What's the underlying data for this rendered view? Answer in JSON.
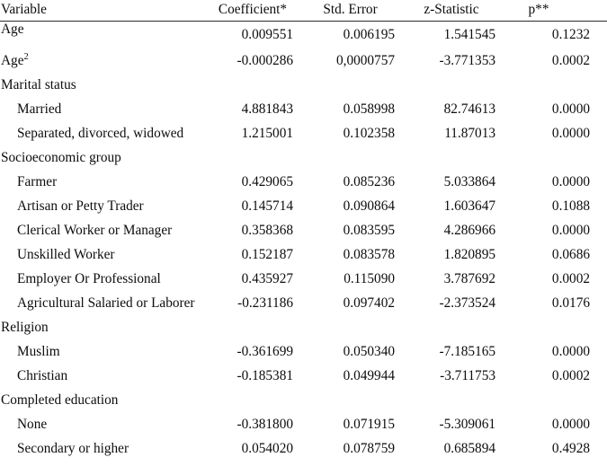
{
  "table": {
    "columns": [
      {
        "key": "variable",
        "label": "Variable",
        "align": "left"
      },
      {
        "key": "coefficient",
        "label": "Coefficient*",
        "align": "right"
      },
      {
        "key": "std_error",
        "label": "Std. Error",
        "align": "right"
      },
      {
        "key": "z_statistic",
        "label": "z-Statistic",
        "align": "right"
      },
      {
        "key": "p_value",
        "label": "p**",
        "align": "right"
      }
    ],
    "rows": [
      {
        "type": "data",
        "label": "Age",
        "label_sup": "",
        "indent": false,
        "coefficient": "0.009551",
        "std_error": "0.006195",
        "z_statistic": "1.541545",
        "p_value": "0.1232"
      },
      {
        "type": "data",
        "label": "Age",
        "label_sup": "2",
        "indent": false,
        "coefficient": "-0.000286",
        "std_error": "0,0000757",
        "z_statistic": "-3.771353",
        "p_value": "0.0002"
      },
      {
        "type": "section",
        "label": "Marital status",
        "label_sup": "",
        "indent": false,
        "coefficient": "",
        "std_error": "",
        "z_statistic": "",
        "p_value": ""
      },
      {
        "type": "data",
        "label": "Married",
        "label_sup": "",
        "indent": true,
        "coefficient": "4.881843",
        "std_error": "0.058998",
        "z_statistic": "82.74613",
        "p_value": "0.0000"
      },
      {
        "type": "data",
        "label": "Separated, divorced, widowed",
        "label_sup": "",
        "indent": true,
        "coefficient": "1.215001",
        "std_error": "0.102358",
        "z_statistic": "11.87013",
        "p_value": "0.0000"
      },
      {
        "type": "section",
        "label": "Socioeconomic group",
        "label_sup": "",
        "indent": false,
        "coefficient": "",
        "std_error": "",
        "z_statistic": "",
        "p_value": ""
      },
      {
        "type": "data",
        "label": "Farmer",
        "label_sup": "",
        "indent": true,
        "coefficient": "0.429065",
        "std_error": "0.085236",
        "z_statistic": "5.033864",
        "p_value": "0.0000"
      },
      {
        "type": "data",
        "label": "Artisan or Petty Trader",
        "label_sup": "",
        "indent": true,
        "coefficient": "0.145714",
        "std_error": "0.090864",
        "z_statistic": "1.603647",
        "p_value": "0.1088"
      },
      {
        "type": "data",
        "label": "Clerical Worker or Manager",
        "label_sup": "",
        "indent": true,
        "coefficient": "0.358368",
        "std_error": "0.083595",
        "z_statistic": "4.286966",
        "p_value": "0.0000"
      },
      {
        "type": "data",
        "label": "Unskilled Worker",
        "label_sup": "",
        "indent": true,
        "coefficient": "0.152187",
        "std_error": "0.083578",
        "z_statistic": "1.820895",
        "p_value": "0.0686"
      },
      {
        "type": "data",
        "label": "Employer Or Professional",
        "label_sup": "",
        "indent": true,
        "coefficient": "0.435927",
        "std_error": "0.115090",
        "z_statistic": "3.787692",
        "p_value": "0.0002"
      },
      {
        "type": "data",
        "label": "Agricultural Salaried or Laborer",
        "label_sup": "",
        "indent": true,
        "coefficient": "-0.231186",
        "std_error": "0.097402",
        "z_statistic": "-2.373524",
        "p_value": "0.0176"
      },
      {
        "type": "section",
        "label": "Religion",
        "label_sup": "",
        "indent": false,
        "coefficient": "",
        "std_error": "",
        "z_statistic": "",
        "p_value": ""
      },
      {
        "type": "data",
        "label": "Muslim",
        "label_sup": "",
        "indent": true,
        "coefficient": "-0.361699",
        "std_error": "0.050340",
        "z_statistic": "-7.185165",
        "p_value": "0.0000"
      },
      {
        "type": "data",
        "label": "Christian",
        "label_sup": "",
        "indent": true,
        "coefficient": "-0.185381",
        "std_error": "0.049944",
        "z_statistic": "-3.711753",
        "p_value": "0.0002"
      },
      {
        "type": "section",
        "label": "Completed education",
        "label_sup": "",
        "indent": false,
        "coefficient": "",
        "std_error": "",
        "z_statistic": "",
        "p_value": ""
      },
      {
        "type": "data",
        "label": "None",
        "label_sup": "",
        "indent": true,
        "coefficient": "-0.381800",
        "std_error": "0.071915",
        "z_statistic": "-5.309061",
        "p_value": "0.0000"
      },
      {
        "type": "data",
        "label": "Secondary or higher",
        "label_sup": "",
        "indent": true,
        "coefficient": "0.054020",
        "std_error": "0.078759",
        "z_statistic": "0.685894",
        "p_value": "0.4928"
      }
    ]
  }
}
